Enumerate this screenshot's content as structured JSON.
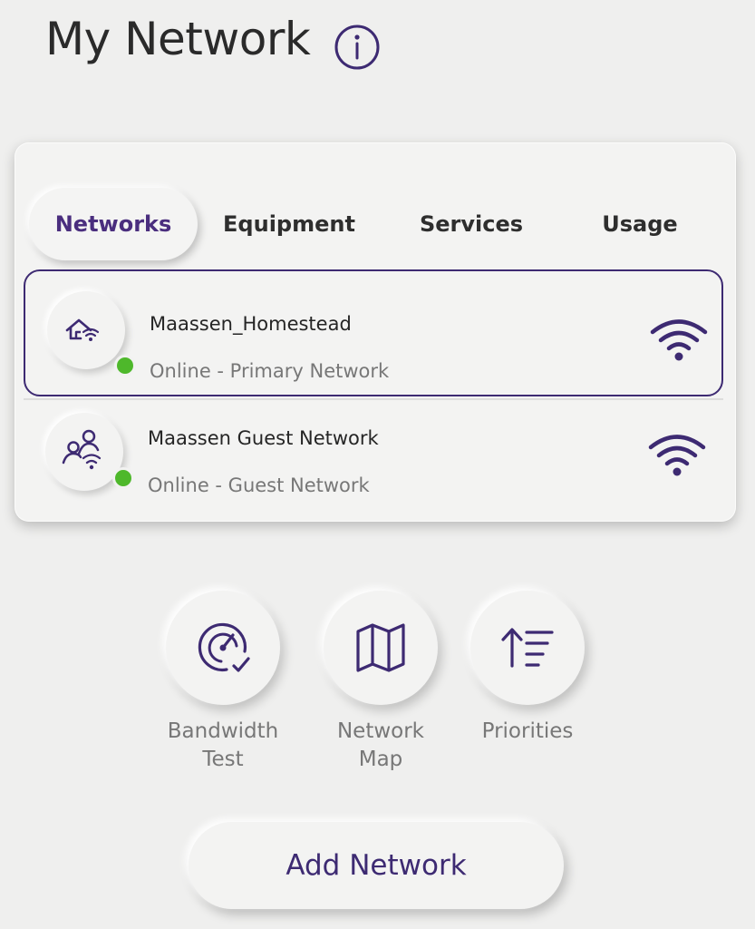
{
  "header": {
    "title": "My Network",
    "info_icon": "info-icon"
  },
  "tabs": [
    {
      "label": "Networks",
      "active": true
    },
    {
      "label": "Equipment",
      "active": false
    },
    {
      "label": "Services",
      "active": false
    },
    {
      "label": "Usage",
      "active": false
    }
  ],
  "networks": [
    {
      "name": "Maassen_Homestead",
      "status": "Online - Primary Network",
      "icon": "home-wifi-icon",
      "signal_icon": "wifi-icon",
      "selected": true
    },
    {
      "name": "Maassen Guest Network",
      "status": "Online - Guest Network",
      "icon": "guest-users-wifi-icon",
      "signal_icon": "wifi-icon",
      "selected": false
    }
  ],
  "actions": [
    {
      "label_line1": "Bandwidth",
      "label_line2": "Test",
      "icon": "speedometer-icon"
    },
    {
      "label_line1": "Network",
      "label_line2": "Map",
      "icon": "map-icon"
    },
    {
      "label_line1": "Priorities",
      "label_line2": "",
      "icon": "priorities-icon"
    }
  ],
  "add_button": {
    "label": "Add Network"
  },
  "colors": {
    "accent": "#3d2a72",
    "background": "#efefee",
    "online": "#4eb82b",
    "muted_text": "#777777"
  }
}
